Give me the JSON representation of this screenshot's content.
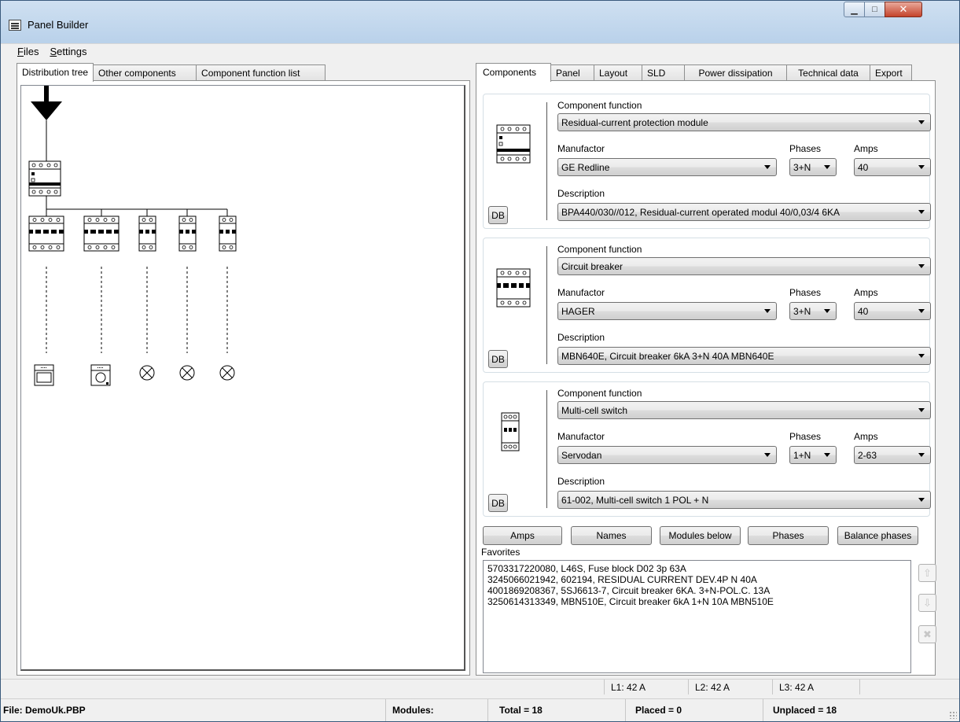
{
  "window": {
    "title": "Panel Builder"
  },
  "menu": [
    {
      "first": "F",
      "rest": "iles"
    },
    {
      "first": "S",
      "rest": "ettings"
    }
  ],
  "left_tabs": [
    "Distribution tree",
    "Other components",
    "Component function list"
  ],
  "right_tabs": [
    "Components",
    "Panel",
    "Layout",
    "SLD",
    "Power dissipation",
    "Technical data",
    "Export"
  ],
  "labels": {
    "component_function": "Component function",
    "manufactor": "Manufactor",
    "phases": "Phases",
    "amps": "Amps",
    "description": "Description",
    "db": "DB"
  },
  "components": [
    {
      "icon": "rcd-module-icon",
      "function": "Residual-current protection module",
      "manufactor": "GE Redline",
      "phases": "3+N",
      "amps": "40",
      "description": "BPA440/030//012, Residual-current operated modul 40/0,03/4 6KA"
    },
    {
      "icon": "circuit-breaker-icon",
      "function": "Circuit breaker",
      "manufactor": "HAGER",
      "phases": "3+N",
      "amps": "40",
      "description": "MBN640E, Circuit breaker 6kA 3+N 40A MBN640E"
    },
    {
      "icon": "multi-cell-switch-icon",
      "function": "Multi-cell switch",
      "manufactor": "Servodan",
      "phases": "1+N",
      "amps": "2-63",
      "description": "61-002, Multi-cell switch 1 POL + N"
    }
  ],
  "actions": [
    "Amps",
    "Names",
    "Modules below",
    "Phases",
    "Balance phases"
  ],
  "favorites": {
    "label": "Favorites",
    "items": [
      "5703317220080, L46S, Fuse block D02 3p 63A",
      "3245066021942, 602194, RESIDUAL CURRENT DEV.4P N 40A",
      "4001869208367, 5SJ6613-7, Circuit breaker 6KA. 3+N-POL.C. 13A",
      "3250614313349, MBN510E, Circuit breaker 6kA 1+N 10A MBN510E"
    ]
  },
  "phase_status": {
    "l1": "L1: 42 A",
    "l2": "L2: 42 A",
    "l3": "L3: 42 A"
  },
  "status": {
    "file": "File: DemoUk.PBP",
    "modules": "Modules:",
    "total": "Total = 18",
    "placed": "Placed = 0",
    "unplaced": "Unplaced = 18"
  },
  "colors": {
    "title_bar": "#c4d9ef",
    "close_button": "#c4432b",
    "window_bg": "#f0f0f0"
  }
}
